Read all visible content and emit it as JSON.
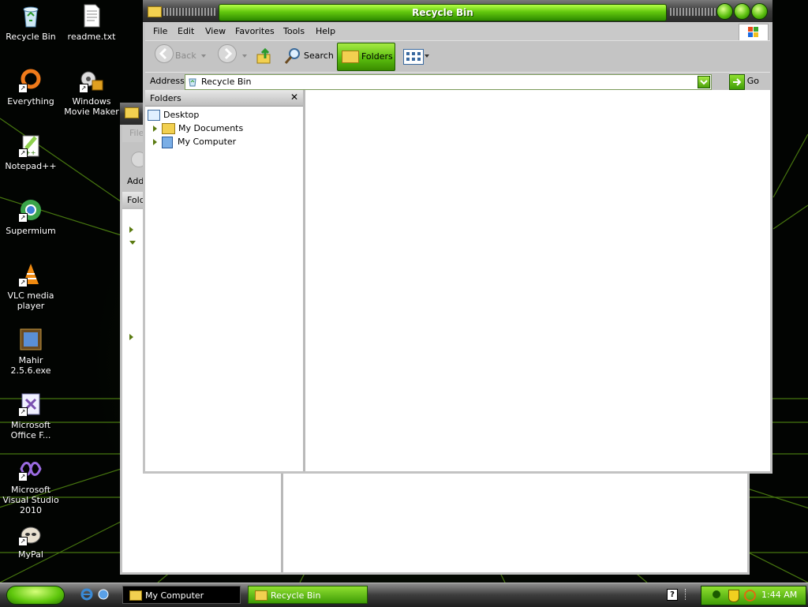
{
  "desktop": {
    "icons": [
      {
        "label": "Recycle Bin",
        "icon": "recycle-bin-icon"
      },
      {
        "label": "readme.txt",
        "icon": "text-file-icon"
      },
      {
        "label": "Everything",
        "icon": "everything-search-icon"
      },
      {
        "label": "Windows Movie Maker",
        "icon": "movie-maker-icon"
      },
      {
        "label": "Notepad++",
        "icon": "notepad-plus-plus-icon"
      },
      {
        "label": "Supermium",
        "icon": "supermium-browser-icon"
      },
      {
        "label": "VLC media player",
        "icon": "vlc-cone-icon"
      },
      {
        "label": "Mahir 2.5.6.exe",
        "icon": "executable-icon"
      },
      {
        "label": "Microsoft Office F...",
        "icon": "office-file-icon"
      },
      {
        "label": "Microsoft Visual Studio 2010",
        "icon": "visual-studio-icon"
      },
      {
        "label": "MyPal",
        "icon": "mypal-browser-icon"
      }
    ]
  },
  "back_window": {
    "menu_first": "File",
    "address_label": "Add",
    "folders_label": "Fold"
  },
  "main_window": {
    "title": "Recycle Bin",
    "menu": [
      "File",
      "Edit",
      "View",
      "Favorites",
      "Tools",
      "Help"
    ],
    "toolbar": {
      "back_label": "Back",
      "search_label": "Search",
      "folders_label": "Folders"
    },
    "address": {
      "label": "Address",
      "value": "Recycle Bin",
      "go_label": "Go"
    },
    "folder_pane": {
      "title": "Folders",
      "close_glyph": "✕",
      "tree": [
        {
          "label": "Desktop",
          "icon": "desktop-icon"
        },
        {
          "label": "My Documents",
          "icon": "my-documents-icon"
        },
        {
          "label": "My Computer",
          "icon": "my-computer-icon"
        }
      ]
    }
  },
  "taskbar": {
    "tasks": [
      {
        "label": "My Computer",
        "active": false
      },
      {
        "label": "Recycle Bin",
        "active": true
      }
    ],
    "clock": "1:44 AM",
    "help_glyph": "?"
  },
  "colors": {
    "accent_green": "#63c80e",
    "titlebar_dark": "#3b3b3b",
    "chrome_gray": "#c4c4c4"
  }
}
